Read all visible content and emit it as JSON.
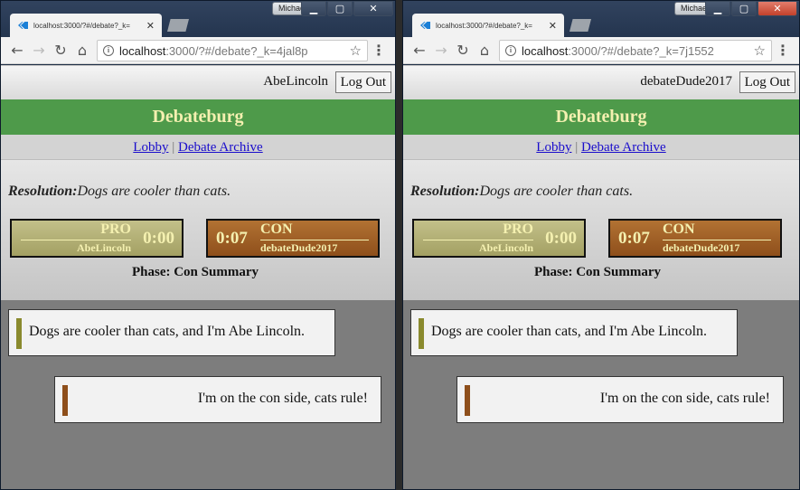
{
  "windows": [
    {
      "os_user": "Michael",
      "tab_title": "localhost:3000/?#/debate?_k=",
      "url_host": "localhost",
      "url_rest": ":3000/?#/debate?_k=4jal8p",
      "username": "AbeLincoln",
      "logout_label": "Log Out"
    },
    {
      "os_user": "Michael",
      "tab_title": "localhost:3000/?#/debate?_k=",
      "url_host": "localhost",
      "url_rest": ":3000/?#/debate?_k=7j1552",
      "username": "debateDude2017",
      "logout_label": "Log Out"
    }
  ],
  "app": {
    "brand": "Debateburg",
    "nav_lobby": "Lobby",
    "nav_sep": "|",
    "nav_archive": "Debate Archive",
    "resolution_label": "Resolution:",
    "resolution_text": "Dogs are cooler than cats.",
    "pro_label": "PRO",
    "pro_user": "AbeLincoln",
    "pro_timer": "0:00",
    "con_label": "CON",
    "con_user": "debateDude2017",
    "con_timer": "0:07",
    "phase": "Phase: Con Summary",
    "messages": [
      {
        "side": "pro",
        "text": "Dogs are cooler than cats, and I'm Abe Lincoln."
      },
      {
        "side": "con",
        "text": "I'm on the con side, cats rule!"
      }
    ]
  },
  "colors": {
    "brand_green": "#4e9a4a",
    "pro_color": "#a3a063",
    "con_color": "#8e4f1b",
    "accent_text": "#f4f0b0"
  },
  "icons": {
    "back": "arrow-left",
    "forward": "arrow-right",
    "reload": "reload",
    "home": "home",
    "info": "info",
    "bookmark": "star",
    "menu": "three-dots"
  }
}
